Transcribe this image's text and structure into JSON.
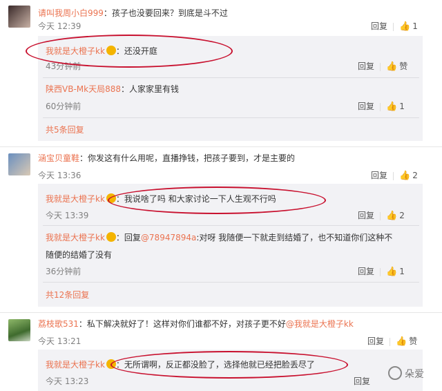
{
  "comments": [
    {
      "user": "请叫我周小白999",
      "text": "：孩子也没要回来？到底是斗不过",
      "time": "今天 12:39",
      "reply_label": "回复",
      "likes": "1",
      "replies": [
        {
          "user": "我就是大橙子kk",
          "text": "：还没开庭",
          "time": "43分钟前",
          "reply_label": "回复",
          "likes": "赞"
        },
        {
          "user": "陕西VB-Mk天局888",
          "text": "：人家家里有钱",
          "time": "60分钟前",
          "reply_label": "回复",
          "likes": "1"
        }
      ],
      "more": "共5条回复"
    },
    {
      "user": "涵宝贝童鞋",
      "text": "：你发这有什么用呢，直播挣钱，把孩子要到，才是主要的",
      "time": "今天 13:36",
      "reply_label": "回复",
      "likes": "2",
      "replies": [
        {
          "user": "我就是大橙子kk",
          "text": "：我说啥了吗 和大家讨论一下人生观不行吗",
          "time": "今天 13:39",
          "reply_label": "回复",
          "likes": "2"
        },
        {
          "user": "我就是大橙子kk",
          "text_prefix": "：回复",
          "mention": "@78947894a",
          "text": ":对呀 我随便一下就走到结婚了，也不知道你们这种不",
          "text2": "随便的结婚了没有",
          "time": "36分钟前",
          "reply_label": "回复",
          "likes": "1"
        }
      ],
      "more": "共12条回复"
    },
    {
      "user": "荔枝歌531",
      "text": "：私下解决就好了！这样对你们谁都不好，对孩子更不好",
      "mention": "@我就是大橙子kk",
      "time": "今天 13:21",
      "reply_label": "回复",
      "likes": "赞",
      "replies": [
        {
          "user": "我就是大橙子kk",
          "text": "：无所谓啊，反正都没脸了，选择他就已经把脸丢尽了",
          "time": "今天 13:23",
          "reply_label": "回复"
        }
      ]
    }
  ],
  "watermark": "朵爱"
}
